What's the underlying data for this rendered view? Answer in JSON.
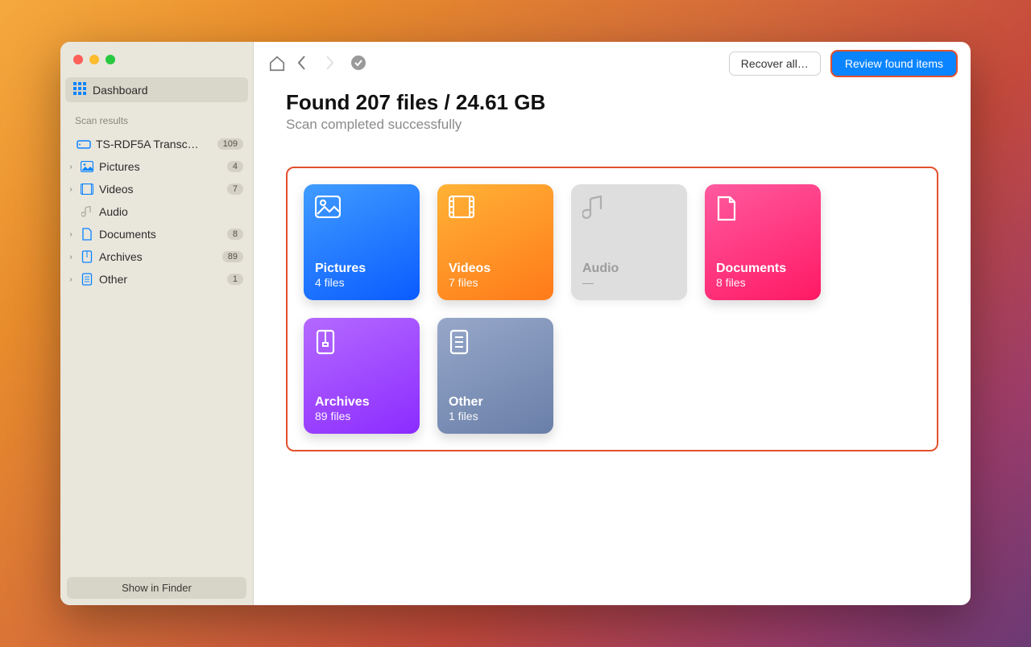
{
  "sidebar": {
    "dashboard_label": "Dashboard",
    "section_label": "Scan results",
    "device": {
      "name": "TS-RDF5A Transc…",
      "count": "109"
    },
    "items": [
      {
        "label": "Pictures",
        "count": "4"
      },
      {
        "label": "Videos",
        "count": "7"
      },
      {
        "label": "Audio",
        "count": ""
      },
      {
        "label": "Documents",
        "count": "8"
      },
      {
        "label": "Archives",
        "count": "89"
      },
      {
        "label": "Other",
        "count": "1"
      }
    ],
    "footer_label": "Show in Finder"
  },
  "toolbar": {
    "recover_label": "Recover all…",
    "review_label": "Review found items"
  },
  "summary": {
    "headline": "Found 207 files / 24.61 GB",
    "subline": "Scan completed successfully"
  },
  "cards": {
    "pictures": {
      "title": "Pictures",
      "sub": "4 files"
    },
    "videos": {
      "title": "Videos",
      "sub": "7 files"
    },
    "audio": {
      "title": "Audio",
      "sub": "—"
    },
    "documents": {
      "title": "Documents",
      "sub": "8 files"
    },
    "archives": {
      "title": "Archives",
      "sub": "89 files"
    },
    "other": {
      "title": "Other",
      "sub": "1 files"
    }
  }
}
